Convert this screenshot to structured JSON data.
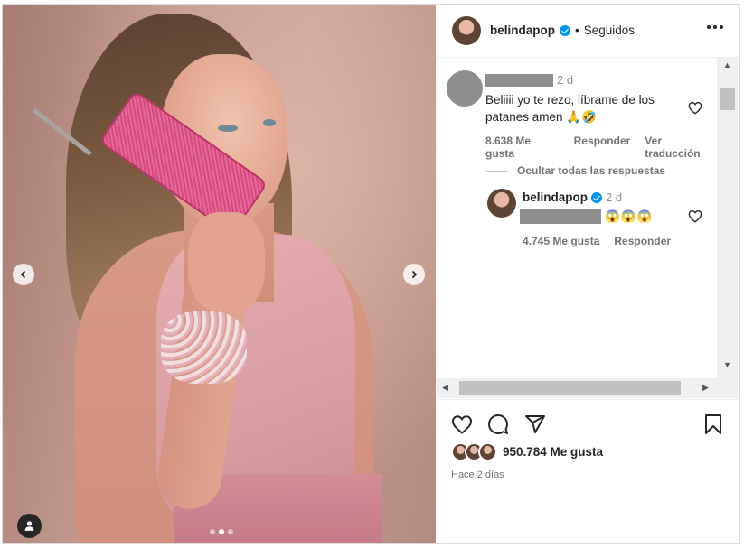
{
  "post": {
    "carousel": {
      "slide_count": 3,
      "active_index": 1
    }
  },
  "header": {
    "username": "belindapop",
    "verified": true,
    "follow_status": "Seguidos",
    "more_icon": "more-horizontal-icon"
  },
  "comments": {
    "top_comment": {
      "username_redacted": true,
      "time": "2 d",
      "text": "Beliiii yo te rezo, líbrame de los patanes amen",
      "emojis": [
        "🙏",
        "🤣"
      ],
      "likes": "8.638 Me gusta",
      "reply_label": "Responder",
      "translate_label": "Ver traducción"
    },
    "hide_replies_label": "Ocultar todas las respuestas",
    "reply": {
      "username": "belindapop",
      "verified": true,
      "time": "2 d",
      "mention_redacted": true,
      "emojis": [
        "😱",
        "😱",
        "😱"
      ],
      "likes": "4.745 Me gusta",
      "reply_label": "Responder"
    }
  },
  "actions": {
    "likes": "950.784 Me gusta",
    "posted": "Hace 2 días"
  },
  "colors": {
    "accent_blue": "#0095f6",
    "text_primary": "#262626",
    "text_secondary": "#737373",
    "redaction_gray": "#8e8e8e"
  }
}
